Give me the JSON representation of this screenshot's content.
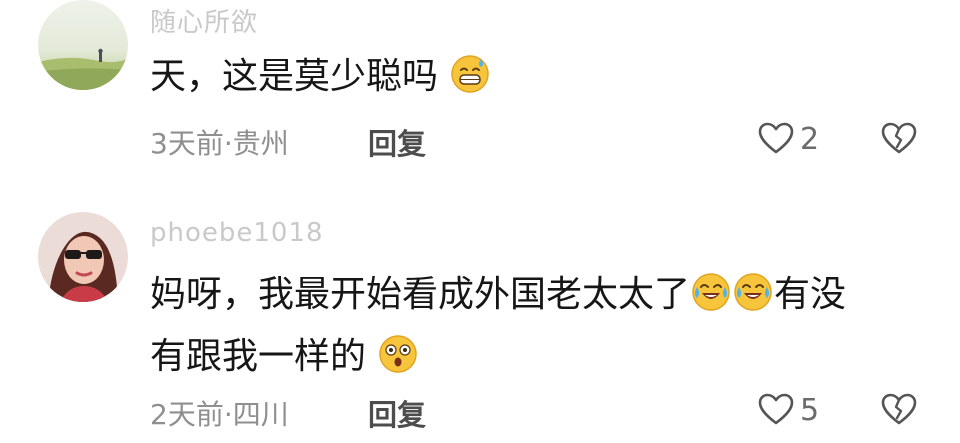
{
  "comments": [
    {
      "username": "随心所欲",
      "text_lines": [
        "天，这是莫少聪吗"
      ],
      "emojis": [
        "grin-sweat-emoji"
      ],
      "meta": "3天前·贵州",
      "reply_label": "回复",
      "like_count": "2"
    },
    {
      "username": "phoebe1018",
      "text_lines": [
        "妈呀，我最开始看成外国老太太了",
        "有没",
        "有跟我一样的"
      ],
      "emojis": [
        "tears-of-joy-emoji",
        "tears-of-joy-emoji",
        "astonished-emoji"
      ],
      "meta": "2天前·四川",
      "reply_label": "回复",
      "like_count": "5"
    }
  ],
  "colors": {
    "text": "#161616",
    "meta": "#8f8f8f",
    "username": "#c9c9c9",
    "icon": "#555555"
  }
}
